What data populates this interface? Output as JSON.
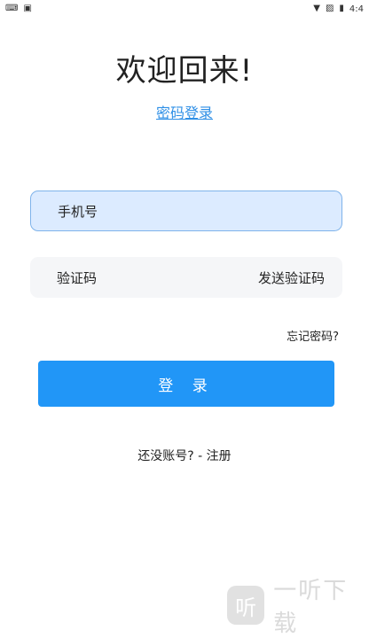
{
  "status": {
    "left_icons": [
      "keyboard-icon",
      "app-a-icon"
    ],
    "time": "4:4"
  },
  "title": "欢迎回来!",
  "mode_link": "密码登录",
  "phone_field": {
    "placeholder": "手机号"
  },
  "code_field": {
    "placeholder": "验证码",
    "send_code_label": "发送验证码"
  },
  "forgot_password": "忘记密码?",
  "login_button": "登 录",
  "register_line": "还没账号? - 注册",
  "watermark": {
    "logo_text": "听",
    "text": "一听下载"
  },
  "colors": {
    "accent": "#2196f7",
    "link": "#2e8fe6",
    "phone_bg": "#dcebff",
    "phone_border": "#7fb3ea",
    "field_bg": "#f5f6f8"
  }
}
